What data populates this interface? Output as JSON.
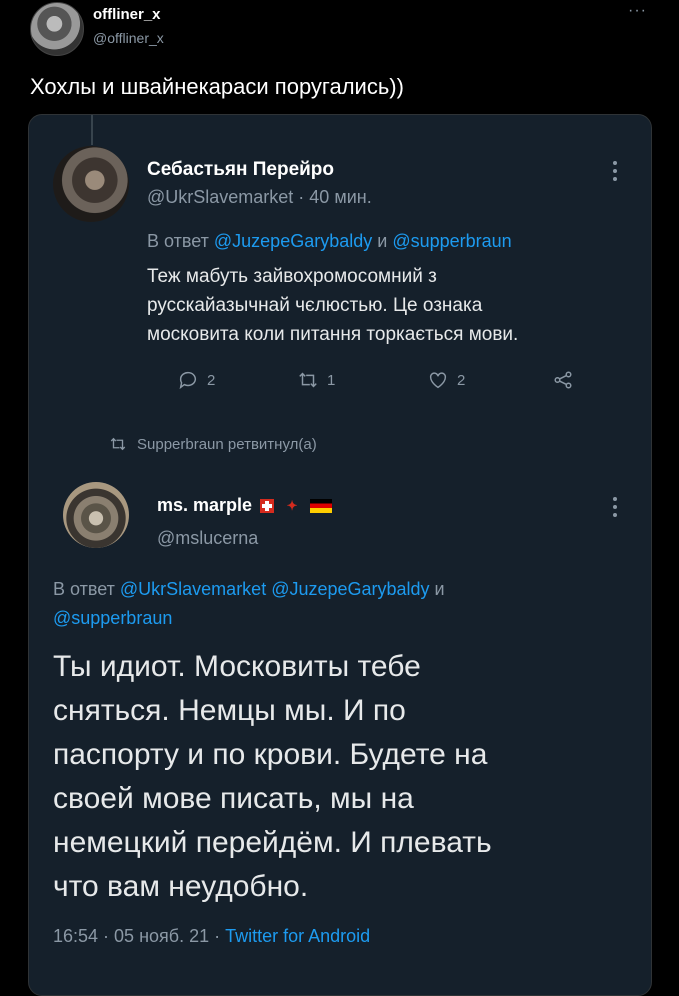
{
  "outer_tweet": {
    "name": "offliner_x",
    "handle": "@offliner_x",
    "more": "···",
    "text": "Хохлы и швайнекараси поругались))"
  },
  "quoted_tweet": {
    "name": "Себастьян Перейро",
    "handle_time": "@UkrSlavemarket · 40 мин.",
    "reply_prefix": "В ответ ",
    "reply_user1": "@JuzepeGarybaldy",
    "reply_and": " и ",
    "reply_user2": "@supperbraun",
    "body": "Теж мабуть зайвохромосомний з\nрусскайазычнай чєлюстью. Це ознака\nмосковита коли питання торкається мови.",
    "replies": "2",
    "retweets": "1",
    "likes": "2"
  },
  "retweet_note": "Supperbraun ретвитнул(а)",
  "reply_tweet": {
    "name": "ms. marple",
    "handle": "@mslucerna",
    "reply_prefix": "В ответ ",
    "reply_users": "@UkrSlavemarket @JuzepeGarybaldy",
    "reply_and": " и",
    "reply_user3": "@supperbraun",
    "body": "Ты идиот. Московиты тебе\nсняться. Немцы мы. И по\nпаспорту и по крови. Будете на\nсвоей мове писать, мы на\nнемецкий перейдём. И плевать\nчто вам неудобно.",
    "time_date": "16:54 · 05 нояб. 21 · ",
    "source": "Twitter for Android"
  },
  "colors": {
    "background": "#000000",
    "card": "#15202b",
    "link": "#1d9bf0",
    "muted": "#8b98a5"
  },
  "icons": [
    "reply-icon",
    "retweet-icon",
    "like-icon",
    "share-icon",
    "more-icon",
    "flag-switzerland",
    "flag-canada",
    "flag-germany"
  ]
}
